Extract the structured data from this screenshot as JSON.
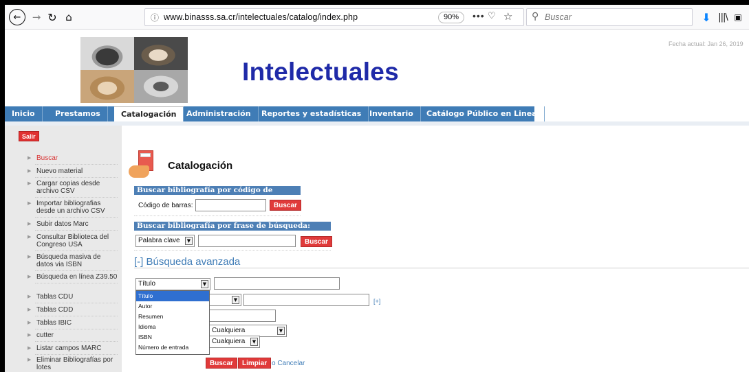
{
  "browser": {
    "url_info_icon": "ⓘ",
    "url": "www.binasss.sa.cr/intelectuales/catalog/index.php",
    "zoom": "90%",
    "more_label": "•••",
    "search_placeholder": "Buscar"
  },
  "header": {
    "title": "Intelectuales",
    "current_date": "Fecha actual: Jan 26, 2019"
  },
  "nav": {
    "tabs": [
      {
        "label": "Inicio"
      },
      {
        "label": "Prestamos"
      },
      {
        "label": "Catalogación"
      },
      {
        "label": "Administración"
      },
      {
        "label": "Reportes y estadísticas"
      },
      {
        "label": "Inventario"
      },
      {
        "label": "Catálogo Público en Linea"
      }
    ],
    "active": "Catalogación"
  },
  "sidebar": {
    "logout_label": "Salir",
    "items": [
      {
        "label": "Buscar"
      },
      {
        "label": "Nuevo material"
      },
      {
        "label": "Cargar copias desde archivo CSV"
      },
      {
        "label": "Importar bibliografias desde un archivo CSV"
      },
      {
        "label": "Subir datos Marc"
      },
      {
        "label": "Consultar Biblioteca del Congreso USA"
      },
      {
        "label": "Búsqueda masiva de datos via ISBN"
      },
      {
        "label": "Búsqueda en línea Z39.50"
      },
      {
        "label": "Tablas CDU"
      },
      {
        "label": "Tablas CDD"
      },
      {
        "label": "Tablas IBIC"
      },
      {
        "label": "cutter"
      },
      {
        "label": "Listar campos MARC"
      },
      {
        "label": "Eliminar Bibliografías por lotes"
      }
    ]
  },
  "main": {
    "section_title": "Catalogación",
    "barcode": {
      "heading": "Buscar bibliografía por código de barras:",
      "label": "Código de barras:",
      "value": "",
      "button": "Buscar"
    },
    "phrase": {
      "heading": "Buscar bibliografía por frase de búsqueda:",
      "select_value": "Palabra clave",
      "value": "",
      "button": "Buscar"
    },
    "advanced": {
      "title": "[-] Búsqueda avanzada",
      "field1_select": "Título",
      "add_label": "[+]",
      "select_any_1": "Cualquiera",
      "select_any_2": "Cualquiera",
      "dropdown_options": [
        "Título",
        "Autor",
        "Resumen",
        "Idioma",
        "ISBN",
        "Número de entrada"
      ],
      "dropdown_selected": "Título",
      "search_button": "Buscar",
      "clear_button": "Limpiar",
      "cancel_link": "o Cancelar"
    }
  }
}
